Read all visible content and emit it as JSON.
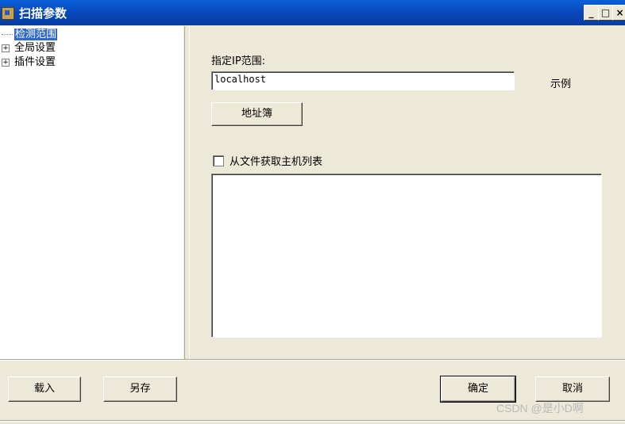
{
  "window": {
    "title": "扫描参数",
    "minimize_glyph": "_",
    "maximize_glyph": "□",
    "close_glyph": "×"
  },
  "tree": {
    "items": [
      {
        "label": "检测范围",
        "selected": true,
        "expander": ""
      },
      {
        "label": "全局设置",
        "selected": false,
        "expander": "+"
      },
      {
        "label": "插件设置",
        "selected": false,
        "expander": "+"
      }
    ]
  },
  "panel": {
    "ip_range_label": "指定IP范围:",
    "ip_range_value": "localhost",
    "example_label": "示例",
    "address_book_button": "地址簿",
    "from_file_checkbox_label": "从文件获取主机列表",
    "from_file_checked": false,
    "host_list": ""
  },
  "footer": {
    "load_button": "载入",
    "save_as_button": "另存",
    "ok_button": "确定",
    "cancel_button": "取消"
  },
  "watermark": "CSDN @是小D啊",
  "colors": {
    "titlebar": "#0746b8",
    "selection": "#316ac5",
    "face": "#ece9d8"
  }
}
